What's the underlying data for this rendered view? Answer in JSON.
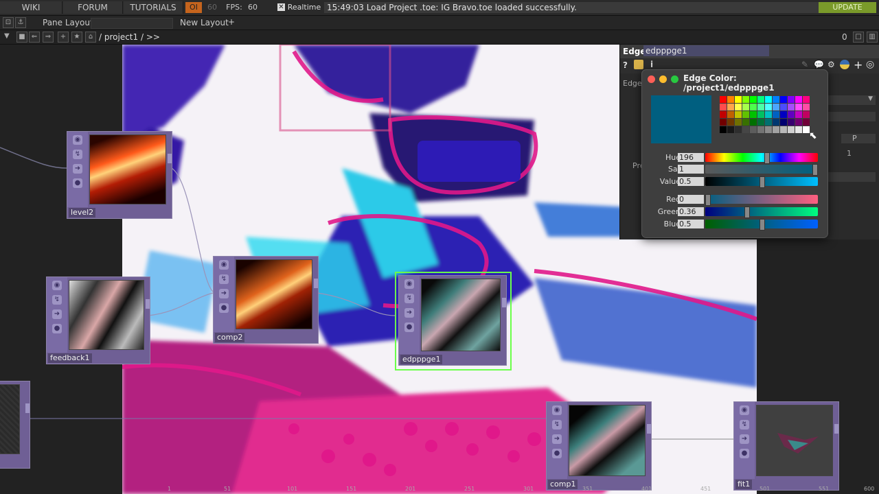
{
  "topbar": {
    "menu": [
      "WIKI",
      "FORUM",
      "TUTORIALS"
    ],
    "oi_label": "OI",
    "oi_count": "60",
    "fps_label": "FPS:",
    "fps_value": "60",
    "realtime_label": "Realtime",
    "log": "15:49:03 Load Project .toe: IG Bravo.toe loaded successfully.",
    "update_label": "UPDATE"
  },
  "bar2": {
    "pane_layout_label": "Pane Layout",
    "new_layout_label": "New Layout",
    "new_layout_plus": "+"
  },
  "bar3": {
    "path": "/ project1 / >>",
    "right_count": "0"
  },
  "nodes": {
    "level2": "level2",
    "feedback1": "feedback1",
    "comp2": "comp2",
    "edpppge1": "edpppge1",
    "comp1": "comp1",
    "fit1": "fit1"
  },
  "param_panel": {
    "op_type": "Edge",
    "op_name": "edpppge1",
    "tab_label": "Edge",
    "partial_label": "Pre",
    "dropdown_p": "P",
    "num_field": "1"
  },
  "color_dialog": {
    "title": "Edge Color:  /project1/edpppge1",
    "swatch_color": "#005f80",
    "rows": [
      {
        "label": "Hue",
        "value": "196"
      },
      {
        "label": "Sat",
        "value": "1"
      },
      {
        "label": "Value",
        "value": "0.5"
      },
      {
        "label": "Red",
        "value": "0"
      },
      {
        "label": "Green",
        "value": "0.36"
      },
      {
        "label": "Blue",
        "value": "0.5"
      }
    ]
  },
  "timeline_ticks": [
    "1",
    "51",
    "101",
    "151",
    "201",
    "251",
    "301",
    "351",
    "401",
    "451",
    "501",
    "551",
    "600"
  ],
  "colors": {
    "accent_green": "#7a9a2a",
    "node_purple": "#6f5f95",
    "selected_outline": "#6bff4a"
  }
}
